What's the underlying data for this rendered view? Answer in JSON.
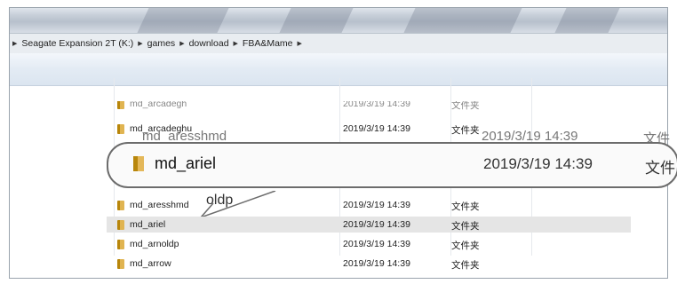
{
  "address": {
    "crumbs": [
      "Seagate Expansion 2T (K:)",
      "games",
      "download",
      "FBA&Mame"
    ]
  },
  "rows_top_clipped": {
    "name": "md_arcadegh",
    "date": "2019/3/19 14:39",
    "type": "文件夹"
  },
  "rows": [
    {
      "name": "md_arcadeghu",
      "date": "2019/3/19 14:39",
      "type": "文件夹"
    },
    {
      "name": "md_aresshmd",
      "date": "2019/3/19 14:39",
      "type": "文件夹"
    },
    {
      "name": "md_ariel",
      "date": "2019/3/19 14:39",
      "type": "文件夹"
    },
    {
      "name": "md_arnoldp",
      "date": "2019/3/19 14:39",
      "type": "文件夹"
    },
    {
      "name": "md_arrow",
      "date": "2019/3/19 14:39",
      "type": "文件夹"
    }
  ],
  "zoom": {
    "ghost_name": "md_aresshmd",
    "ghost_date": "2019/3/19 14:39",
    "ghost_type": "文件",
    "name": "md_ariel",
    "date": "2019/3/19 14:39",
    "type": "文件",
    "under_label": "oldp"
  }
}
